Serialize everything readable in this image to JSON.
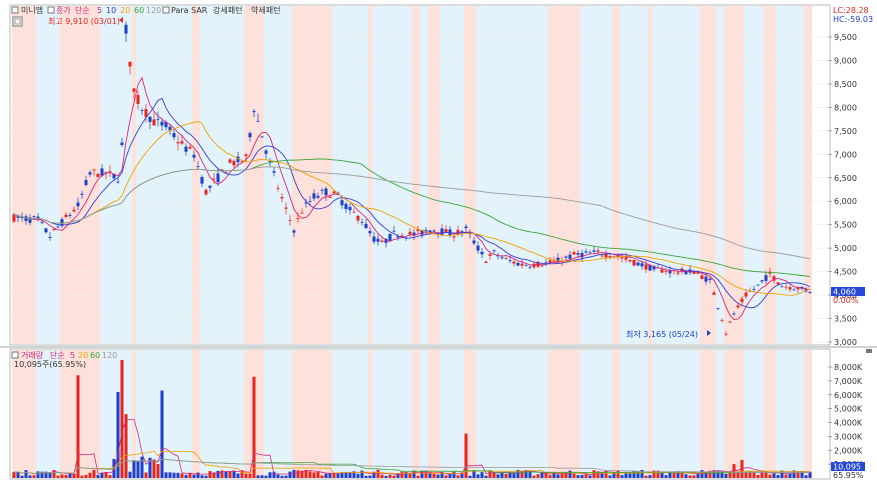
{
  "colors": {
    "bg_pink": "#fde1da",
    "bg_blue": "#e3f3fb",
    "up": "#e8261f",
    "down": "#1f3fc8",
    "ma5": "#d7267b",
    "ma10": "#3b3bd1",
    "ma20": "#f0a100",
    "ma60": "#3aa53a",
    "ma120": "#9a9a9a",
    "price_badge": "#2548d8"
  },
  "top_legend": {
    "title": "미니맵",
    "price_label": "종가",
    "ma_label": "단순",
    "periods": [
      "5",
      "10",
      "20",
      "60",
      "120"
    ],
    "indicator": "Para SAR",
    "pattern_strong": "강세패턴",
    "pattern_weak": "약세패턴"
  },
  "stats": {
    "lc": "LC:28.28",
    "hc": "HC:-59.03"
  },
  "price_axis": [
    "9,500",
    "9,000",
    "8,500",
    "8,000",
    "7,500",
    "7,000",
    "6,500",
    "6,000",
    "5,500",
    "5,000",
    "4,500",
    "4,000",
    "3,500",
    "3,000"
  ],
  "current_price": {
    "value": "4,060",
    "change": "0.00%"
  },
  "annotations": {
    "high": "최고 9,910 (03/01)",
    "low": "최저 3,165 (05/24)"
  },
  "volume_legend": {
    "title": "거래량",
    "ma_label": "단순",
    "periods": [
      "5",
      "20",
      "60",
      "120"
    ],
    "summary": "10,095주(65.95%)"
  },
  "volume_axis": [
    "8,000K",
    "7,000K",
    "6,000K",
    "5,000K",
    "4,000K",
    "3,000K",
    "2,000K",
    "1,000K"
  ],
  "current_volume": {
    "value": "10,095",
    "pct": "65.95%"
  }
}
